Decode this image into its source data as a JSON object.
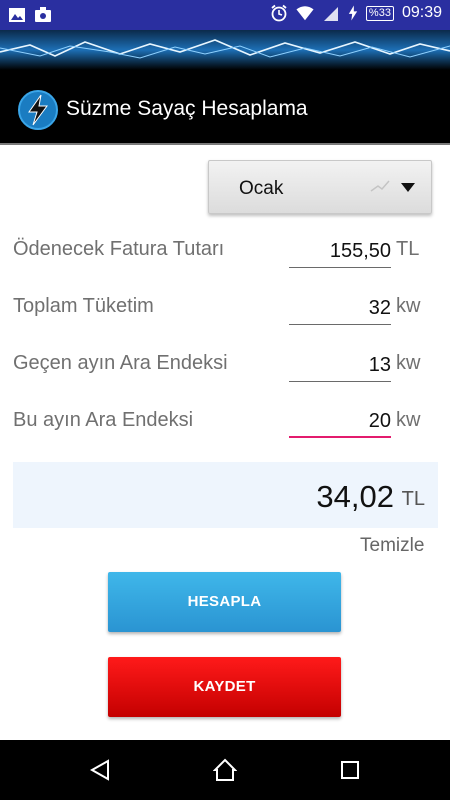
{
  "status_bar": {
    "battery": "%33",
    "time": "09:39",
    "left_icons": [
      "gallery-icon",
      "camera-notification-icon"
    ],
    "right_icons": [
      "alarm-icon",
      "wifi-icon",
      "signal-icon",
      "charging-icon"
    ]
  },
  "app_bar": {
    "title": "Süzme Sayaç Hesaplama",
    "icon": "lightning-bolt-icon"
  },
  "month_spinner": {
    "selected": "Ocak"
  },
  "form": {
    "rows": [
      {
        "label": "Ödenecek Fatura Tutarı",
        "value": "155,50",
        "unit": "TL"
      },
      {
        "label": "Toplam Tüketim",
        "value": "32",
        "unit": "kw"
      },
      {
        "label": "Geçen ayın Ara Endeksi",
        "value": "13",
        "unit": "kw"
      },
      {
        "label": "Bu ayın Ara Endeksi",
        "value": "20",
        "unit": "kw"
      }
    ]
  },
  "result": {
    "value": "34,02",
    "unit": "TL"
  },
  "actions": {
    "clear_label": "Temizle",
    "calculate_label": "HESAPLA",
    "save_label": "KAYDET"
  },
  "colors": {
    "status_bar": "#2a2fa0",
    "active_underline": "#e31b6d",
    "calculate_button": "#2fa6df",
    "save_button": "#e60000",
    "result_background": "#eef5fd"
  },
  "nav": {
    "buttons": [
      "back-icon",
      "home-icon",
      "recents-icon"
    ]
  }
}
